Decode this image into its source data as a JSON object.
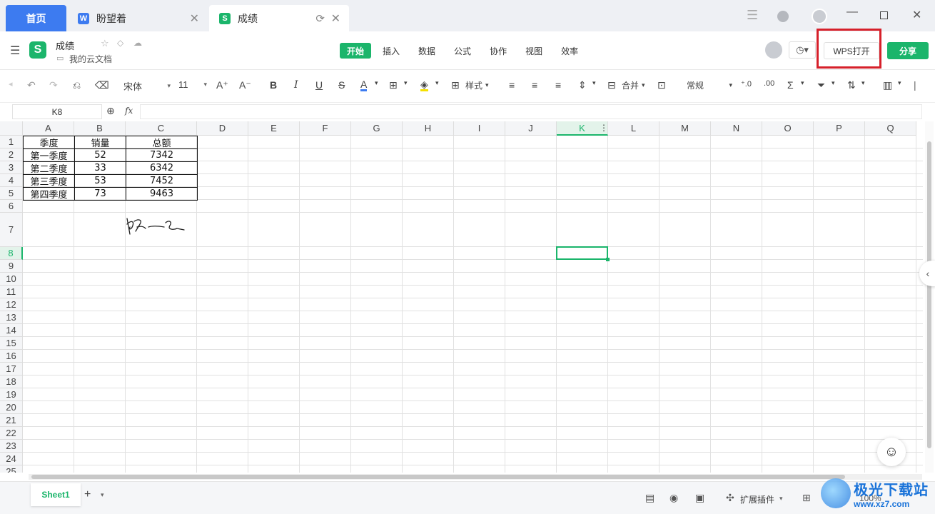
{
  "tabs": {
    "home": "首页",
    "doc1": {
      "icon": "W",
      "title": "盼望着"
    },
    "doc2": {
      "icon": "S",
      "title": "成绩"
    }
  },
  "header": {
    "doc_title": "成绩",
    "location": "我的云文档",
    "wps_open": "WPS打开",
    "share": "分享",
    "menu": [
      "开始",
      "插入",
      "数据",
      "公式",
      "协作",
      "视图",
      "效率"
    ]
  },
  "toolbar": {
    "font_name": "宋体",
    "font_size": "11",
    "style_label": "样式",
    "merge_label": "合并",
    "number_format": "常规"
  },
  "formula": {
    "name_box": "K8",
    "fx": "fx"
  },
  "grid": {
    "columns": [
      "A",
      "B",
      "C",
      "D",
      "E",
      "F",
      "G",
      "H",
      "I",
      "J",
      "K",
      "L",
      "M",
      "N",
      "O",
      "P",
      "Q"
    ],
    "rows": [
      "1",
      "2",
      "3",
      "4",
      "5",
      "6",
      "7",
      "8",
      "9",
      "10",
      "11",
      "12",
      "13",
      "14",
      "15",
      "16",
      "17",
      "18",
      "19",
      "20",
      "21",
      "22",
      "23",
      "24",
      "25"
    ],
    "table": {
      "header": [
        "季度",
        "销量",
        "总额"
      ],
      "data": [
        [
          "第一季度",
          "52",
          "7342"
        ],
        [
          "第二季度",
          "33",
          "6342"
        ],
        [
          "第三季度",
          "53",
          "7452"
        ],
        [
          "第四季度",
          "73",
          "9463"
        ]
      ]
    },
    "selected_cell": "K8"
  },
  "bottom": {
    "sheet_name": "Sheet1",
    "plugins": "扩展插件",
    "zoom": "100%",
    "watermark": "极光下载站",
    "watermark_url": "www.xz7.com"
  },
  "colors": {
    "accent": "#1bb56b",
    "home_tab": "#3d7bf0",
    "highlight_box": "#d6202a"
  }
}
